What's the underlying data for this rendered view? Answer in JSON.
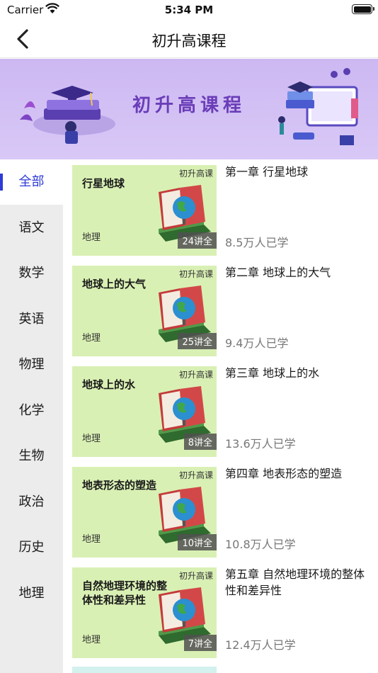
{
  "status_bar": {
    "carrier": "Carrier",
    "time": "5:34 PM"
  },
  "nav": {
    "title": "初升高课程",
    "back_icon": "chevron-left-icon"
  },
  "banner": {
    "title": "初升高课程"
  },
  "sidebar": {
    "active_color": "#2f3bd6",
    "items": [
      {
        "label": "全部",
        "active": true
      },
      {
        "label": "语文"
      },
      {
        "label": "数学"
      },
      {
        "label": "英语"
      },
      {
        "label": "物理"
      },
      {
        "label": "化学"
      },
      {
        "label": "生物"
      },
      {
        "label": "政治"
      },
      {
        "label": "历史"
      },
      {
        "label": "地理"
      }
    ]
  },
  "courses": [
    {
      "tag": "初升高课",
      "title": "行星地球",
      "subject": "地理",
      "count": "24讲全",
      "chapter": "第一章 行星地球",
      "learners": "8.5万人已学"
    },
    {
      "tag": "初升高课",
      "title": "地球上的大气",
      "subject": "地理",
      "count": "25讲全",
      "chapter": "第二章 地球上的大气",
      "learners": "9.4万人已学"
    },
    {
      "tag": "初升高课",
      "title": "地球上的水",
      "subject": "地理",
      "count": "8讲全",
      "chapter": "第三章 地球上的水",
      "learners": "13.6万人已学"
    },
    {
      "tag": "初升高课",
      "title": "地表形态的塑造",
      "subject": "地理",
      "count": "10讲全",
      "chapter": "第四章 地表形态的塑造",
      "learners": "10.8万人已学"
    },
    {
      "tag": "初升高课",
      "title": "自然地理环境的整体性和差异性",
      "subject": "地理",
      "count": "7讲全",
      "chapter": "第五章 自然地理环境的整体性和差异性",
      "learners": "12.4万人已学"
    }
  ]
}
